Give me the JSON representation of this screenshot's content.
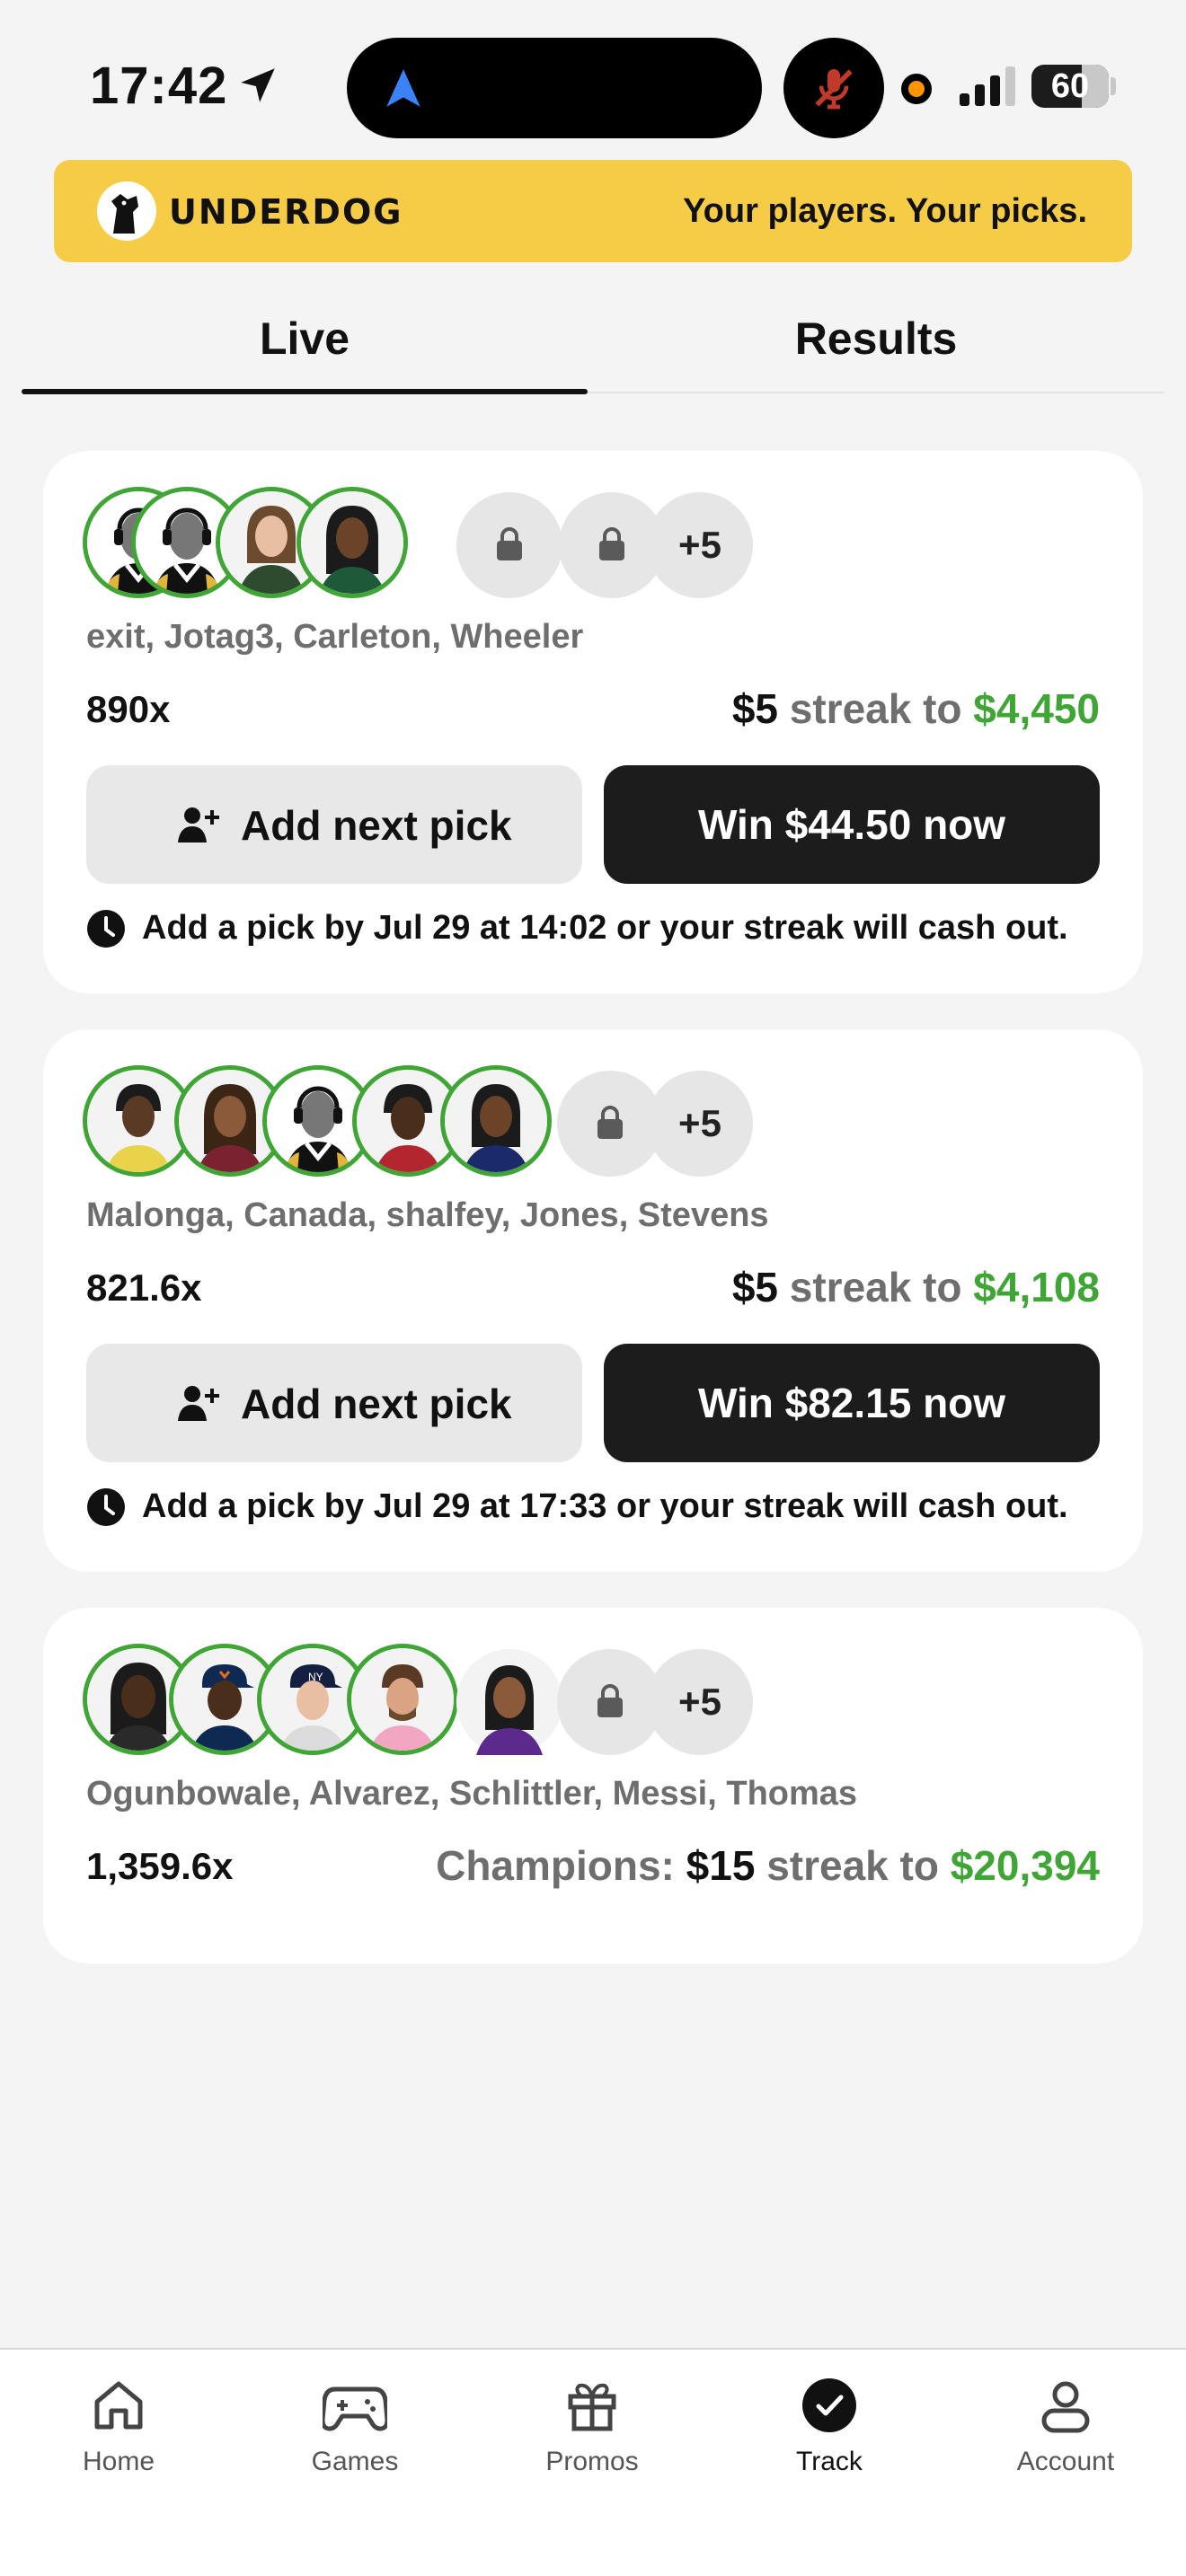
{
  "status_bar": {
    "time": "17:42",
    "battery": "60"
  },
  "banner": {
    "logo_text": "UNDERDOG",
    "tagline": "Your players. Your picks."
  },
  "tabs": [
    {
      "label": "Live",
      "active": true
    },
    {
      "label": "Results",
      "active": false
    }
  ],
  "entries": [
    {
      "avatars": [
        "placeholder-headset",
        "placeholder-headset",
        "player-photo",
        "player-photo"
      ],
      "locked_count": 2,
      "more_label": "+5",
      "names": "exit, Jotag3, Carleton, Wheeler",
      "multiplier": "890x",
      "streak_prefix": "",
      "entry_amount": "$5",
      "streak_text": "streak to",
      "payout": "$4,450",
      "add_pick_label": "Add next pick",
      "win_label": "Win $44.50 now",
      "deadline": "Add a pick by Jul 29 at 14:02 or your streak will cash out."
    },
    {
      "avatars": [
        "player-photo",
        "player-photo",
        "placeholder-headset",
        "player-photo",
        "player-photo"
      ],
      "locked_count": 1,
      "more_label": "+5",
      "names": "Malonga, Canada, shalfey, Jones, Stevens",
      "multiplier": "821.6x",
      "streak_prefix": "",
      "entry_amount": "$5",
      "streak_text": "streak to",
      "payout": "$4,108",
      "add_pick_label": "Add next pick",
      "win_label": "Win $82.15 now",
      "deadline": "Add a pick by Jul 29 at 17:33 or your streak will cash out."
    },
    {
      "avatars": [
        "player-photo",
        "player-photo",
        "player-photo",
        "player-photo",
        "player-photo"
      ],
      "locked_count": 1,
      "more_label": "+5",
      "names": "Ogunbowale, Alvarez, Schlittler, Messi, Thomas",
      "multiplier": "1,359.6x",
      "streak_prefix": "Champions:",
      "entry_amount": "$15",
      "streak_text": "streak to",
      "payout": "$20,394"
    }
  ],
  "bottom_nav": [
    {
      "label": "Home",
      "icon": "home-icon"
    },
    {
      "label": "Games",
      "icon": "gamepad-icon"
    },
    {
      "label": "Promos",
      "icon": "gift-icon"
    },
    {
      "label": "Track",
      "icon": "check-circle-icon",
      "active": true
    },
    {
      "label": "Account",
      "icon": "person-icon"
    }
  ],
  "colors": {
    "brand_yellow": "#f6cc47",
    "win_green": "#3fa535",
    "dark_button": "#1c1c1c"
  }
}
